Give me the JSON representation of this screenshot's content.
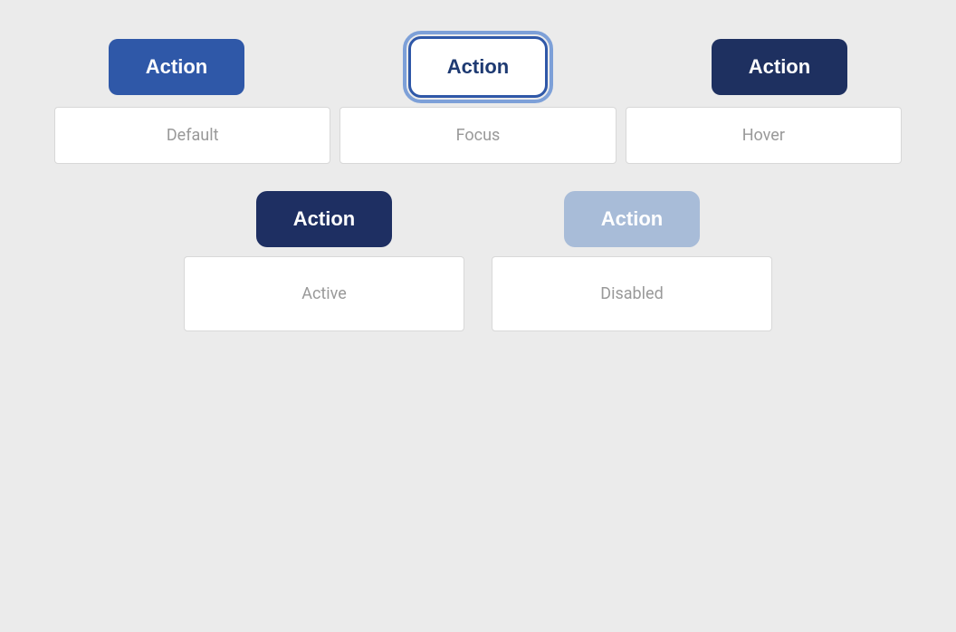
{
  "buttons": {
    "default_label": "Action",
    "focus_label": "Action",
    "hover_label": "Action",
    "active_label": "Action",
    "disabled_label": "Action"
  },
  "labels": {
    "default": "Default",
    "focus": "Focus",
    "hover": "Hover",
    "active": "Active",
    "disabled": "Disabled"
  },
  "colors": {
    "default_bg": "#2f58a8",
    "hover_bg": "#1e3060",
    "active_bg": "#1e2f62",
    "disabled_bg": "#a8bcd8",
    "focus_bg": "#ffffff",
    "focus_text": "#1e3a72",
    "white": "#ffffff"
  }
}
